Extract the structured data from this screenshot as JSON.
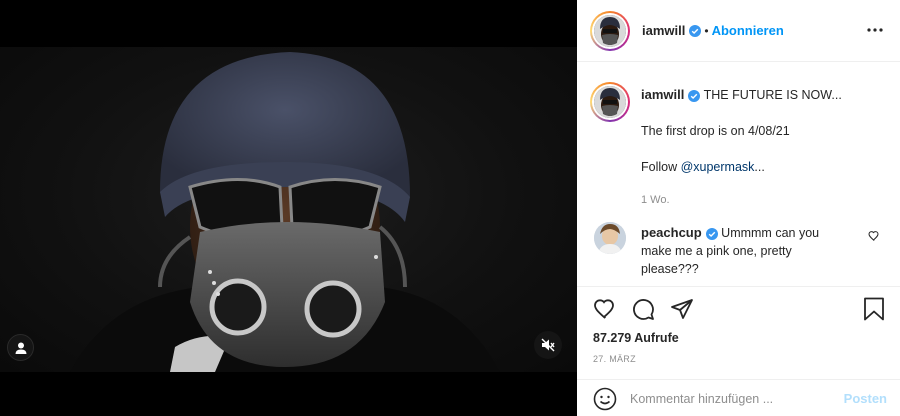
{
  "post": {
    "author": {
      "username": "iamwill",
      "verified": true,
      "follow_label": "Abonnieren",
      "separator": "•"
    },
    "caption": {
      "username": "iamwill",
      "line1": "THE FUTURE IS NOW...",
      "line2": "The first drop is on 4/08/21",
      "line3_prefix": "Follow ",
      "line3_mention": "@xupermask",
      "line3_suffix": "...",
      "age": "1 Wo."
    },
    "comments": [
      {
        "username": "peachcup",
        "verified": true,
        "text": "Ummmm can you make me a pink one, pretty please???"
      }
    ],
    "views": "87.279 Aufrufe",
    "date": "27. MÄRZ",
    "comment_input": {
      "placeholder": "Kommentar hinzufügen ...",
      "value": ""
    },
    "post_button": "Posten"
  },
  "icons": {
    "more": "more-horizontal-icon",
    "like": "heart-icon",
    "comment": "comment-bubble-icon",
    "share": "paper-plane-icon",
    "save": "bookmark-icon",
    "emoji": "emoji-smile-icon",
    "user_tag": "user-tag-icon",
    "mute": "speaker-muted-icon",
    "verified": "verified-badge-icon"
  },
  "colors": {
    "accent": "#0095f6",
    "mention": "#00376b",
    "muted_text": "#8e8e8e",
    "post_disabled": "#b2dffc",
    "verified": "#3897f0"
  }
}
